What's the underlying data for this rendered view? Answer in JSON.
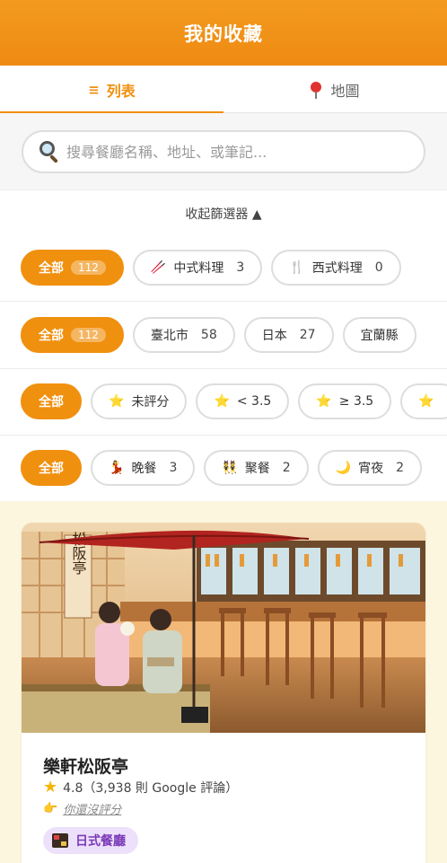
{
  "header": {
    "title": "我的收藏"
  },
  "tabs": [
    {
      "label": "列表",
      "icon": "list-icon",
      "active": true
    },
    {
      "label": "地圖",
      "icon": "map-pin-icon",
      "active": false
    }
  ],
  "search": {
    "placeholder": "搜尋餐廳名稱、地址、或筆記..."
  },
  "filters": {
    "collapse_label": "收起篩選器 ▲",
    "cuisine": [
      {
        "label": "全部",
        "count": "112",
        "active": true
      },
      {
        "label": "中式料理",
        "count": "3",
        "icon": "🥢"
      },
      {
        "label": "西式料理",
        "count": "0",
        "icon": "🍴"
      }
    ],
    "location": [
      {
        "label": "全部",
        "count": "112",
        "active": true
      },
      {
        "label": "臺北市",
        "count": "58"
      },
      {
        "label": "日本",
        "count": "27"
      },
      {
        "label": "宜蘭縣",
        "count": ""
      }
    ],
    "rating": [
      {
        "label": "全部",
        "active": true
      },
      {
        "label": "未評分",
        "icon": "⭐"
      },
      {
        "label": "< 3.5",
        "icon": "⭐"
      },
      {
        "label": "≥ 3.5",
        "icon": "⭐"
      },
      {
        "label": "",
        "icon": "⭐"
      }
    ],
    "occasion": [
      {
        "label": "全部",
        "active": true
      },
      {
        "label": "晚餐",
        "count": "3",
        "icon": "💃"
      },
      {
        "label": "聚餐",
        "count": "2",
        "icon": "👯"
      },
      {
        "label": "宵夜",
        "count": "2",
        "icon": "🌙"
      }
    ]
  },
  "card": {
    "title": "樂軒松阪亭",
    "rating": "4.8（3,938 則 Google 評論）",
    "rate_prompt": "你還沒評分",
    "tag": "日式餐廳",
    "photo_sign": "松阪亭"
  },
  "colors": {
    "accent": "#f0900f",
    "cream": "#fdf6df",
    "tag_bg": "#ece0fb",
    "tag_text": "#7b3ab8"
  }
}
